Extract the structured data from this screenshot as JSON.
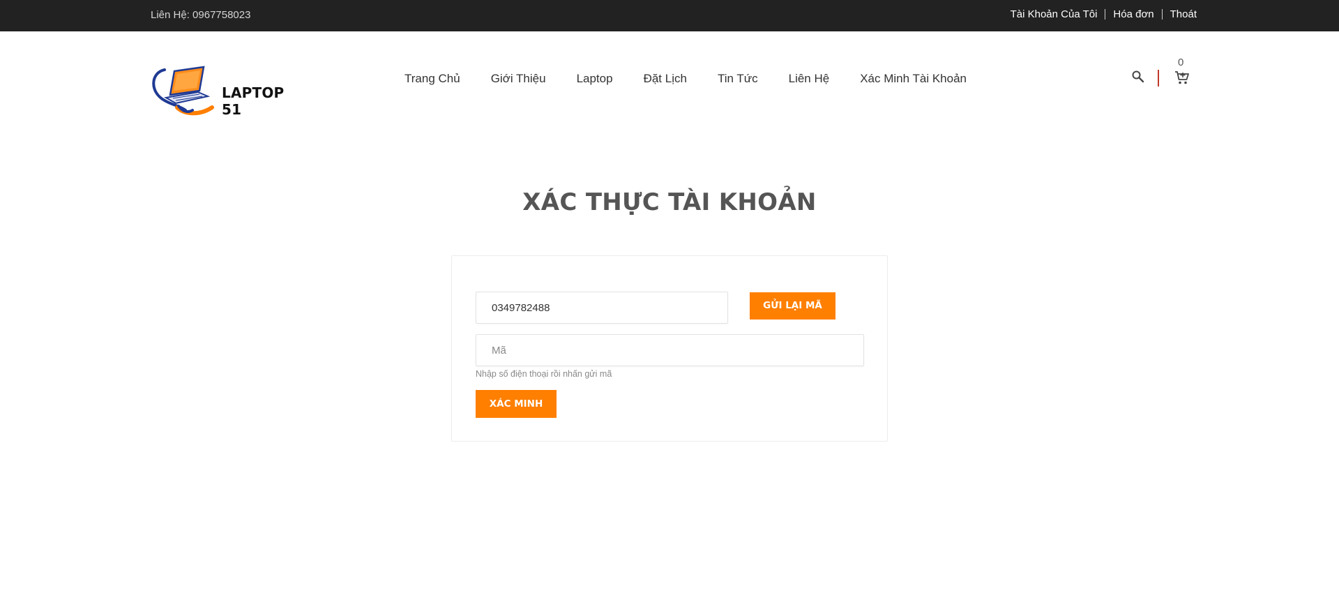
{
  "topbar": {
    "contact": "Liên Hệ: 0967758023",
    "links": [
      "Tài Khoản Của Tôi",
      "Hóa đơn",
      "Thoát"
    ]
  },
  "header": {
    "logo_text": "LAPTOP 51",
    "nav": [
      "Trang Chủ",
      "Giới Thiệu",
      "Laptop",
      "Đặt Lịch",
      "Tin Tức",
      "Liên Hệ",
      "Xác Minh Tài Khoản"
    ],
    "cart_count": "0",
    "icons": [
      "search-icon",
      "cart-icon"
    ]
  },
  "page": {
    "title": "XÁC THỰC TÀI KHOẢN"
  },
  "form": {
    "phone_value": "0349782488",
    "resend_label": "GỬI LẠI MÃ",
    "code_placeholder": "Mã",
    "hint": "Nhập số điện thoại rồi nhấn gửi mã",
    "verify_label": "XÁC MINH"
  },
  "colors": {
    "accent": "#ff7f00",
    "topbar": "#222222"
  }
}
